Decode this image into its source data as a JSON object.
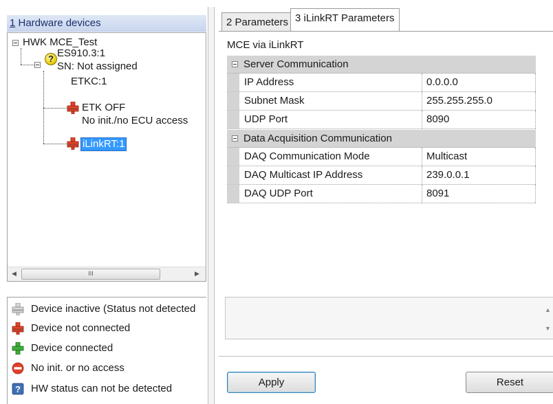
{
  "left_pane": {
    "header": {
      "hotkey": "1",
      "title": " Hardware devices"
    },
    "tree": {
      "root": "HWK MCE_Test",
      "es910_name": "ES910.3:1",
      "es910_sn": "SN: Not assigned",
      "etkc_label": "ETKC:1",
      "etk_off": "ETK OFF",
      "no_init": "No init./no ECU access",
      "ilinkrt": "iLinkRT:1"
    },
    "scrollbar": {
      "left_arrow": "◀",
      "right_arrow": "▶",
      "grip": "III"
    },
    "legend": [
      {
        "icon": "plug-gray-icon",
        "label": "Device inactive (Status not detected"
      },
      {
        "icon": "plug-red-icon",
        "label": "Device not connected"
      },
      {
        "icon": "plug-green-icon",
        "label": "Device connected"
      },
      {
        "icon": "no-entry-icon",
        "label": "No init. or no access"
      },
      {
        "icon": "question-box-icon",
        "label": "HW status can not be detected"
      }
    ]
  },
  "tabs": [
    {
      "label": "2 Parameters",
      "active": false
    },
    {
      "label": "3 iLinkRT Parameters",
      "active": true
    }
  ],
  "panel": {
    "title": "MCE via iLinkRT",
    "groups": [
      {
        "label": "Server Communication",
        "rows": [
          {
            "name": "IP Address",
            "value": "0.0.0.0"
          },
          {
            "name": "Subnet Mask",
            "value": "255.255.255.0"
          },
          {
            "name": "UDP Port",
            "value": "8090"
          }
        ]
      },
      {
        "label": "Data Acquisition Communication",
        "rows": [
          {
            "name": "DAQ Communication Mode",
            "value": "Multicast"
          },
          {
            "name": "DAQ Multicast IP Address",
            "value": "239.0.0.1"
          },
          {
            "name": "DAQ UDP Port",
            "value": "8091"
          }
        ]
      }
    ],
    "description_scroll": {
      "up": "▲",
      "down": "▼"
    }
  },
  "buttons": {
    "apply": "Apply",
    "reset": "Reset"
  },
  "colors": {
    "plug_red": "#e2452b",
    "plug_green": "#3fae3a",
    "plug_gray": "#b8b8b8",
    "selection": "#3399ff",
    "no_entry": "#e0402a",
    "question_box": "#3f6fb5"
  }
}
